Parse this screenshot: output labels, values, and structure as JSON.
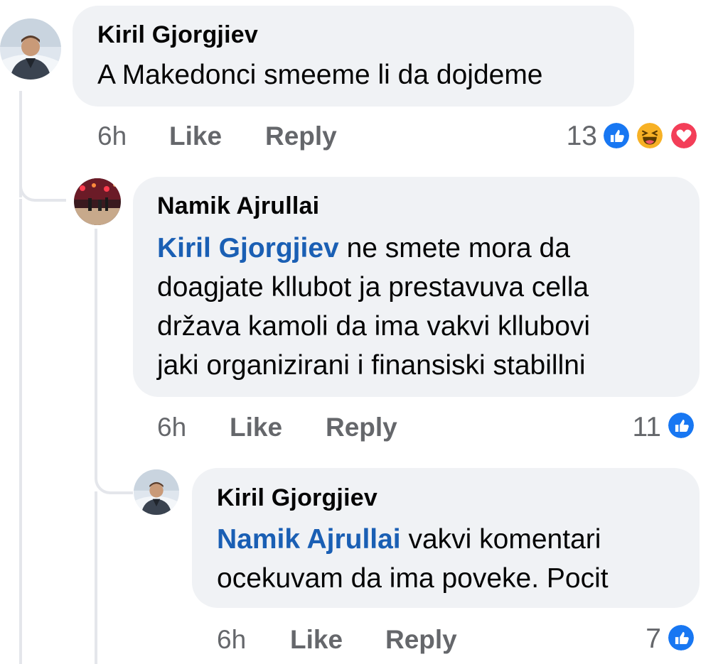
{
  "comments": [
    {
      "author": "Kiril Gjorgjiev",
      "mention": "",
      "text": "A Makedonci smeeme li da dojdeme",
      "time": "6h",
      "like_label": "Like",
      "reply_label": "Reply",
      "reaction_count": "13",
      "reactions": [
        "like-reaction-icon",
        "haha-reaction-icon",
        "love-reaction-icon"
      ]
    },
    {
      "author": "Namik Ajrullai",
      "mention": "Kiril Gjorgjiev",
      "text_lines": [
        " ne smete mora da",
        "doagjate kllubot ja prestavuva cella",
        "država kamoli da ima vakvi kllubovi",
        "jaki organizirani i finansiski stabillni"
      ],
      "time": "6h",
      "like_label": "Like",
      "reply_label": "Reply",
      "reaction_count": "11",
      "reactions": [
        "like-reaction-icon"
      ]
    },
    {
      "author": "Kiril Gjorgjiev",
      "mention": "Namik Ajrullai",
      "text_lines": [
        " vakvi komentari",
        "ocekuvam da ima poveke. Pocit"
      ],
      "time": "6h",
      "like_label": "Like",
      "reply_label": "Reply",
      "reaction_count": "7",
      "reactions": [
        "like-reaction-icon"
      ]
    }
  ],
  "colors": {
    "bubble": "#f0f2f5",
    "mention": "#1a5fb4",
    "meta": "#65676b",
    "like_blue": "#1877f2",
    "love_red": "#f33e58",
    "haha_yellow": "#f7b125"
  }
}
